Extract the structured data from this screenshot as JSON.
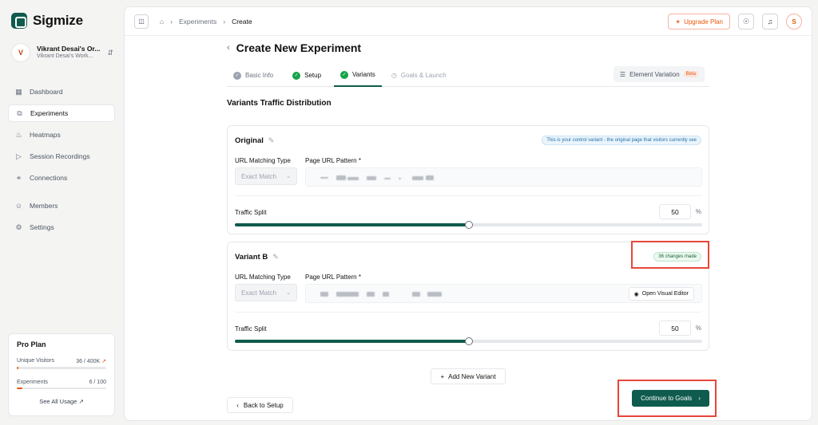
{
  "brand": {
    "name": "Sigmize"
  },
  "org": {
    "avatar": "V",
    "name": "Vikrant Desai's Or...",
    "workspace": "Vikrant Desai's Work..."
  },
  "nav": [
    {
      "label": "Dashboard",
      "icon": "dashboard-icon"
    },
    {
      "label": "Experiments",
      "icon": "experiments-icon",
      "active": true
    },
    {
      "label": "Heatmaps",
      "icon": "heatmaps-icon"
    },
    {
      "label": "Session Recordings",
      "icon": "video-icon"
    },
    {
      "label": "Connections",
      "icon": "connections-icon"
    },
    {
      "label": "Members",
      "icon": "members-icon"
    },
    {
      "label": "Settings",
      "icon": "gear-icon"
    }
  ],
  "plan": {
    "title": "Pro Plan",
    "visitors_label": "Unique Visitors",
    "visitors_value": "36 / 400K",
    "visitors_fraction": 0.0001,
    "experiments_label": "Experiments",
    "experiments_value": "6 / 100",
    "experiments_fraction": 0.06,
    "see_all": "See All Usage"
  },
  "breadcrumb": {
    "parent": "Experiments",
    "current": "Create"
  },
  "topbar": {
    "upgrade": "Upgrade Plan",
    "user_initial": "S"
  },
  "page": {
    "title": "Create New Experiment",
    "tabs": [
      {
        "label": "Basic Info",
        "state": "done-muted"
      },
      {
        "label": "Setup",
        "state": "done"
      },
      {
        "label": "Variants",
        "state": "active"
      },
      {
        "label": "Goals & Launch",
        "state": "disabled"
      }
    ],
    "element_variation": "Element Variation",
    "beta": "Beta",
    "section_title": "Variants Traffic Distribution"
  },
  "variants": [
    {
      "name": "Original",
      "badge": "This is your control variant - the original page that visitors currently see",
      "badge_style": "blue",
      "url_matching_label": "URL Matching Type",
      "url_matching_value": "Exact Match",
      "page_url_label": "Page URL Pattern *",
      "traffic_label": "Traffic Split",
      "traffic_value": "50",
      "traffic_fraction": 0.5,
      "percent_sign": "%"
    },
    {
      "name": "Variant B",
      "badge": "36 changes made",
      "badge_style": "green",
      "url_matching_label": "URL Matching Type",
      "url_matching_value": "Exact Match",
      "page_url_label": "Page URL Pattern *",
      "visual_editor": "Open Visual Editor",
      "traffic_label": "Traffic Split",
      "traffic_value": "50",
      "traffic_fraction": 0.5,
      "percent_sign": "%"
    }
  ],
  "actions": {
    "add_variant": "Add New Variant",
    "back": "Back to Setup",
    "continue": "Continue to Goals"
  },
  "colors": {
    "accent": "#0f5b4d",
    "success": "#16a34a",
    "warning": "#ea580c",
    "annotation": "#e8463a"
  }
}
